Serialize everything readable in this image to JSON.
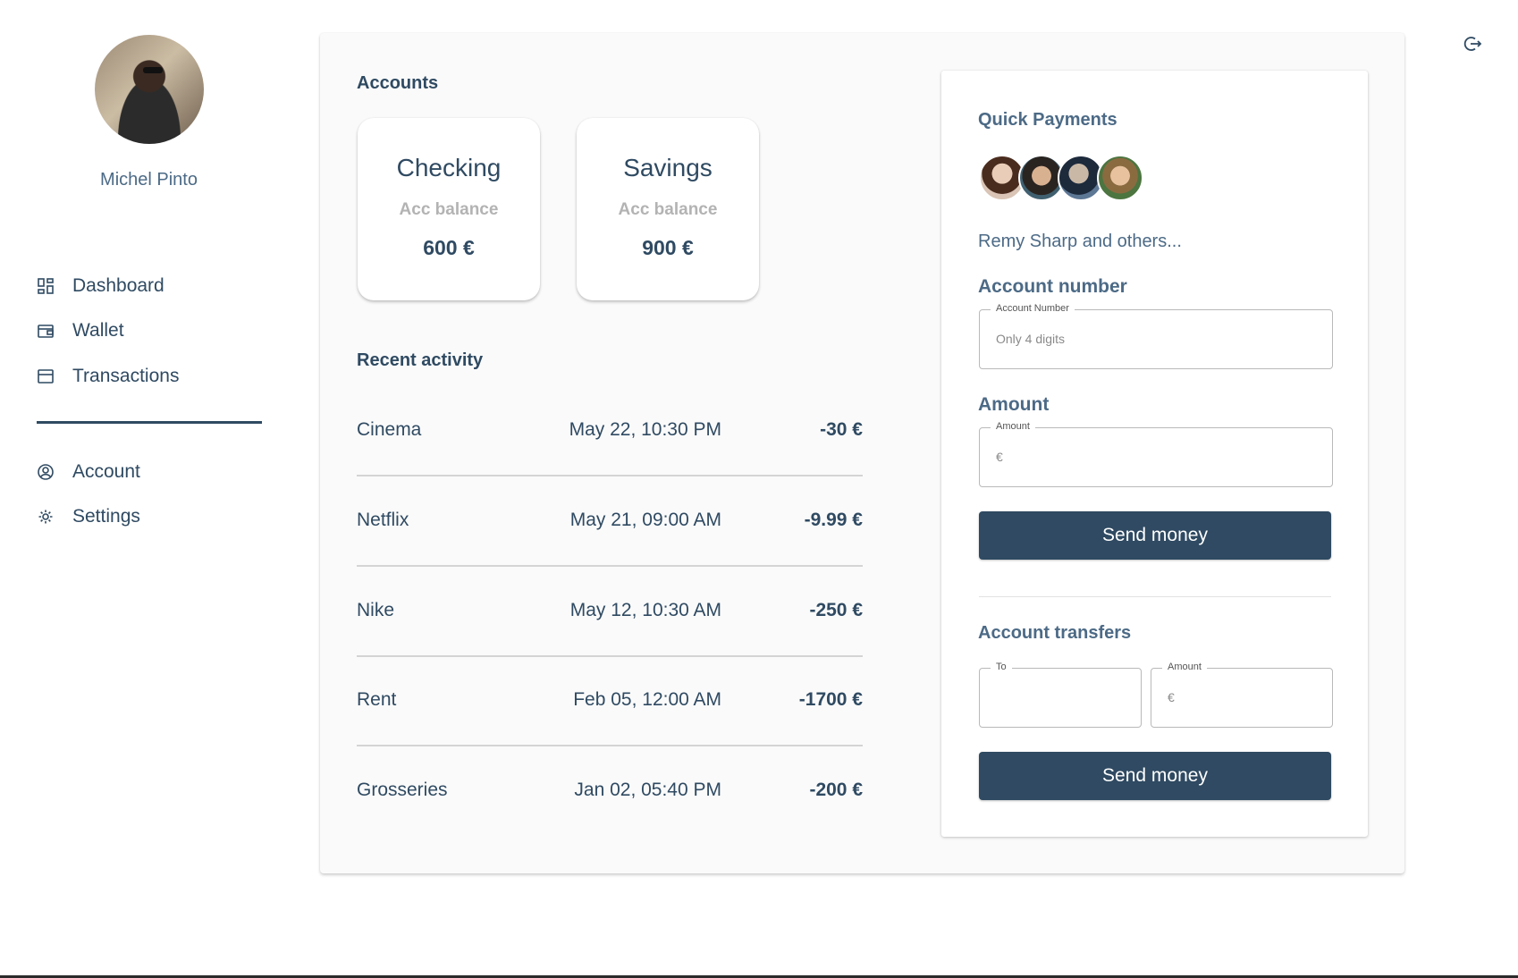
{
  "sidebar": {
    "user_name": "Michel Pinto",
    "items": [
      {
        "label": "Dashboard",
        "icon": "dashboard-icon"
      },
      {
        "label": "Wallet",
        "icon": "wallet-icon"
      },
      {
        "label": "Transactions",
        "icon": "transactions-icon"
      },
      {
        "label": "Account",
        "icon": "account-circle-icon"
      },
      {
        "label": "Settings",
        "icon": "gear-icon"
      }
    ]
  },
  "accounts": {
    "title": "Accounts",
    "cards": [
      {
        "name": "Checking",
        "subtitle": "Acc balance",
        "balance": "600 €"
      },
      {
        "name": "Savings",
        "subtitle": "Acc balance",
        "balance": "900 €"
      }
    ]
  },
  "recent_activity": {
    "title": "Recent activity",
    "rows": [
      {
        "name": "Cinema",
        "date": "May 22, 10:30 PM",
        "amount": "-30 €"
      },
      {
        "name": "Netflix",
        "date": "May 21, 09:00 AM",
        "amount": "-9.99 €"
      },
      {
        "name": "Nike",
        "date": "May 12, 10:30 AM",
        "amount": "-250 €"
      },
      {
        "name": "Rent",
        "date": "Feb 05, 12:00 AM",
        "amount": "-1700 €"
      },
      {
        "name": "Grosseries",
        "date": "Jan 02, 05:40 PM",
        "amount": "-200 €"
      }
    ]
  },
  "quick_payments": {
    "title": "Quick Payments",
    "others_text": "Remy Sharp and others...",
    "account_number": {
      "label": "Account number",
      "legend": "Account Number",
      "placeholder": "Only 4 digits"
    },
    "amount": {
      "label": "Amount",
      "legend": "Amount",
      "prefix": "€"
    },
    "send_label": "Send money"
  },
  "account_transfers": {
    "title": "Account transfers",
    "to_legend": "To",
    "amount_legend": "Amount",
    "amount_prefix": "€",
    "send_label": "Send money"
  },
  "colors": {
    "primary": "#2f4a62",
    "muted_text": "#4c6a86",
    "panel_bg": "#fafafa"
  }
}
